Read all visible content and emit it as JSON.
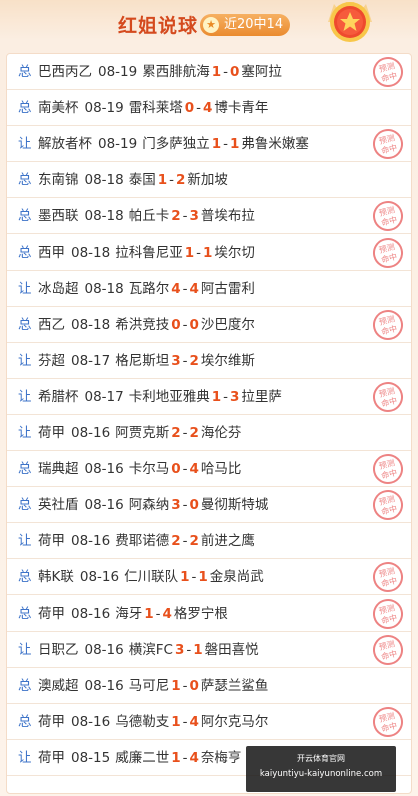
{
  "header": {
    "title": "红姐说球",
    "badge_text": "近20中14"
  },
  "stamp_text": [
    "预测",
    "命中"
  ],
  "rows": [
    {
      "type": "总",
      "league": "巴西丙乙",
      "date": "08-19",
      "home": "累西腓航海",
      "hs": "1",
      "as": "0",
      "away": "塞阿拉",
      "hit": true
    },
    {
      "type": "总",
      "league": "南美杯",
      "date": "08-19",
      "home": "雷科莱塔",
      "hs": "0",
      "as": "4",
      "away": "博卡青年",
      "hit": false
    },
    {
      "type": "让",
      "league": "解放者杯",
      "date": "08-19",
      "home": "门多萨独立",
      "hs": "1",
      "as": "1",
      "away": "弗鲁米嫩塞",
      "hit": true
    },
    {
      "type": "总",
      "league": "东南锦",
      "date": "08-18",
      "home": "泰国",
      "hs": "1",
      "as": "2",
      "away": "新加坡",
      "hit": false
    },
    {
      "type": "总",
      "league": "墨西联",
      "date": "08-18",
      "home": "帕丘卡",
      "hs": "2",
      "as": "3",
      "away": "普埃布拉",
      "hit": true
    },
    {
      "type": "总",
      "league": "西甲",
      "date": "08-18",
      "home": "拉科鲁尼亚",
      "hs": "1",
      "as": "1",
      "away": "埃尔切",
      "hit": true
    },
    {
      "type": "让",
      "league": "冰岛超",
      "date": "08-18",
      "home": "瓦路尔",
      "hs": "4",
      "as": "4",
      "away": "阿古雷利",
      "hit": false
    },
    {
      "type": "总",
      "league": "西乙",
      "date": "08-18",
      "home": "希洪竞技",
      "hs": "0",
      "as": "0",
      "away": "沙巴度尔",
      "hit": true
    },
    {
      "type": "让",
      "league": "芬超",
      "date": "08-17",
      "home": "格尼斯坦",
      "hs": "3",
      "as": "2",
      "away": "埃尔维斯",
      "hit": false
    },
    {
      "type": "让",
      "league": "希腊杯",
      "date": "08-17",
      "home": "卡利地亚雅典",
      "hs": "1",
      "as": "3",
      "away": "拉里萨",
      "hit": true
    },
    {
      "type": "让",
      "league": "荷甲",
      "date": "08-16",
      "home": "阿贾克斯",
      "hs": "2",
      "as": "2",
      "away": "海伦芬",
      "hit": false
    },
    {
      "type": "总",
      "league": "瑞典超",
      "date": "08-16",
      "home": "卡尔马",
      "hs": "0",
      "as": "4",
      "away": "哈马比",
      "hit": true
    },
    {
      "type": "总",
      "league": "英社盾",
      "date": "08-16",
      "home": "阿森纳",
      "hs": "3",
      "as": "0",
      "away": "曼彻斯特城",
      "hit": true
    },
    {
      "type": "让",
      "league": "荷甲",
      "date": "08-16",
      "home": "费耶诺德",
      "hs": "2",
      "as": "2",
      "away": "前进之鹰",
      "hit": false
    },
    {
      "type": "总",
      "league": "韩K联",
      "date": "08-16",
      "home": "仁川联队",
      "hs": "1",
      "as": "1",
      "away": "金泉尚武",
      "hit": true
    },
    {
      "type": "总",
      "league": "荷甲",
      "date": "08-16",
      "home": "海牙",
      "hs": "1",
      "as": "4",
      "away": "格罗宁根",
      "hit": true
    },
    {
      "type": "让",
      "league": "日职乙",
      "date": "08-16",
      "home": "横滨FC",
      "hs": "3",
      "as": "1",
      "away": "磐田喜悦",
      "hit": true
    },
    {
      "type": "总",
      "league": "澳威超",
      "date": "08-16",
      "home": "马可尼",
      "hs": "1",
      "as": "0",
      "away": "萨瑟兰鲨鱼",
      "hit": false
    },
    {
      "type": "总",
      "league": "荷甲",
      "date": "08-16",
      "home": "乌德勒支",
      "hs": "1",
      "as": "4",
      "away": "阿尔克马尔",
      "hit": true
    },
    {
      "type": "让",
      "league": "荷甲",
      "date": "08-15",
      "home": "威廉二世",
      "hs": "1",
      "as": "4",
      "away": "奈梅亨",
      "hit": false
    }
  ],
  "watermark": {
    "line1": "开云体育官网",
    "line2": "kaiyuntiyu-kaiyunonline.com"
  }
}
